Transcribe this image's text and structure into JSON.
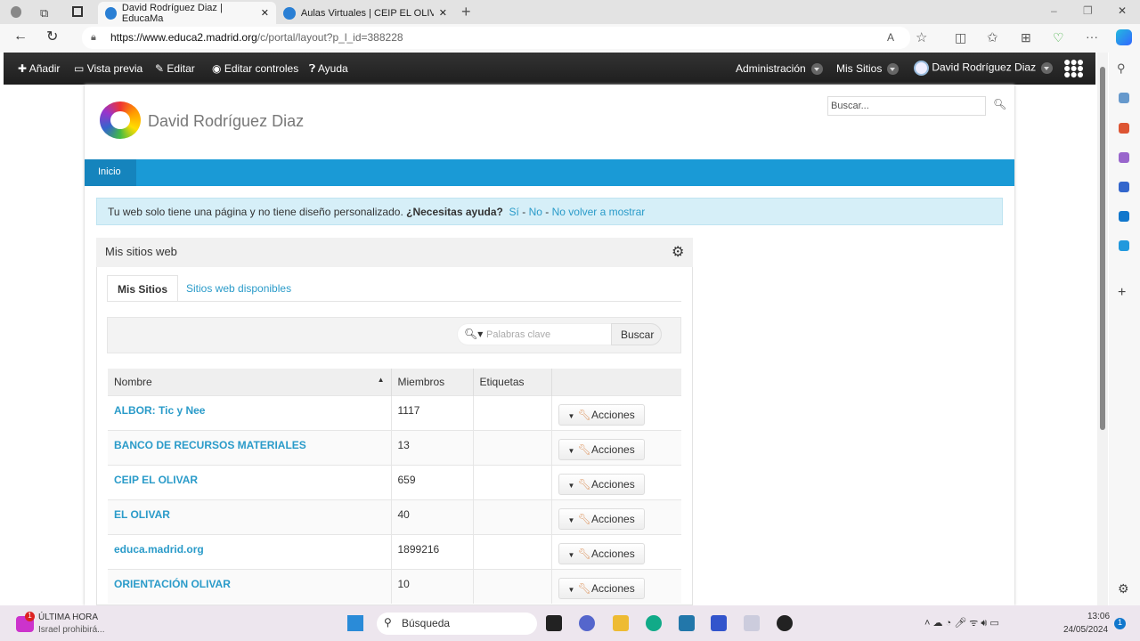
{
  "browser": {
    "tabs": [
      {
        "title": "David Rodríguez Diaz | EducaMa"
      },
      {
        "title": "Aulas Virtuales | CEIP EL OLIVAR"
      }
    ],
    "url_host": "https://www.educa2.madrid.org",
    "url_path": "/c/portal/layout?p_l_id=388228"
  },
  "toolbar": {
    "left": [
      "Añadir",
      "Vista previa",
      "Editar",
      "Editar controles",
      "Ayuda"
    ],
    "admin": "Administración",
    "sites": "Mis Sitios",
    "user": "David Rodríguez Diaz"
  },
  "site": {
    "title": "David Rodríguez Diaz",
    "search_placeholder": "Buscar...",
    "nav_home": "Inicio"
  },
  "alert": {
    "text": "Tu web solo tiene una página y no tiene diseño personalizado.",
    "question": "¿Necesitas ayuda?",
    "yes": "Sí",
    "no": "No",
    "never": "No volver a mostrar",
    "sep": "-"
  },
  "portlet": {
    "title": "Mis sitios web",
    "tabs": [
      "Mis Sitios",
      "Sitios web disponibles"
    ],
    "search_placeholder": "Palabras clave",
    "search_button": "Buscar",
    "columns": [
      "Nombre",
      "Miembros",
      "Etiquetas"
    ],
    "rows": [
      {
        "name": "ALBOR: Tic y Nee",
        "members": "1117",
        "action": "Acciones"
      },
      {
        "name": "BANCO DE RECURSOS MATERIALES",
        "members": "13",
        "action": "Acciones"
      },
      {
        "name": "CEIP EL OLIVAR",
        "members": "659",
        "action": "Acciones"
      },
      {
        "name": "EL OLIVAR",
        "members": "40",
        "action": "Acciones"
      },
      {
        "name": "educa.madrid.org",
        "members": "1899216",
        "action": "Acciones"
      },
      {
        "name": "ORIENTACIÓN OLIVAR",
        "members": "10",
        "action": "Acciones"
      }
    ]
  },
  "taskbar": {
    "news_title": "ÚLTIMA HORA",
    "news_sub": "Israel prohibirá...",
    "news_badge": "1",
    "search": "Búsqueda",
    "time": "13:06",
    "date": "24/05/2024",
    "notif": "1"
  }
}
